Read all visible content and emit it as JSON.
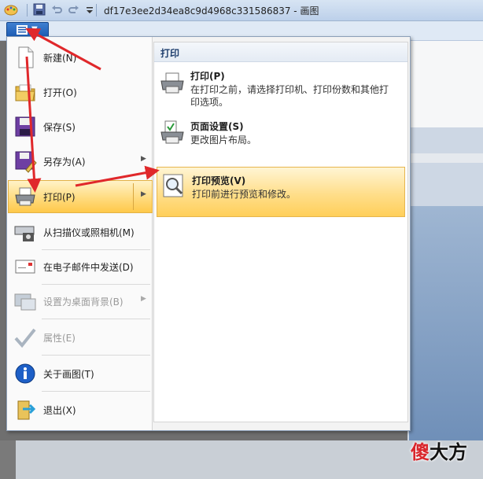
{
  "window": {
    "title": "df17e3ee2d34ea8c9d4968c331586837 - 画图"
  },
  "quick_access": {
    "icons": [
      "paint-app-icon",
      "save-icon",
      "undo-icon",
      "redo-icon",
      "customize-dropdown-icon"
    ]
  },
  "app_menu": {
    "items": [
      {
        "label": "新建(N)",
        "icon": "new-file-icon"
      },
      {
        "label": "打开(O)",
        "icon": "open-folder-icon"
      },
      {
        "label": "保存(S)",
        "icon": "floppy-disk-icon"
      },
      {
        "label": "另存为(A)",
        "icon": "save-as-icon",
        "submenu": true
      },
      {
        "label": "打印(P)",
        "icon": "printer-icon",
        "submenu": true,
        "highlighted": true
      },
      {
        "label": "从扫描仪或照相机(M)",
        "icon": "scanner-icon"
      },
      {
        "label": "在电子邮件中发送(D)",
        "icon": "email-icon"
      },
      {
        "label": "设置为桌面背景(B)",
        "icon": "desktop-background-icon",
        "submenu": true,
        "disabled": true
      },
      {
        "label": "属性(E)",
        "icon": "checkmark-icon",
        "disabled": true
      },
      {
        "label": "关于画图(T)",
        "icon": "info-icon"
      },
      {
        "label": "退出(X)",
        "icon": "exit-icon"
      }
    ]
  },
  "print_submenu": {
    "header": "打印",
    "items": [
      {
        "title": "打印(P)",
        "desc": "在打印之前，请选择打印机、打印份数和其他打印选项。",
        "icon": "printer-icon"
      },
      {
        "title": "页面设置(S)",
        "desc": "更改图片布局。",
        "icon": "page-setup-icon"
      },
      {
        "title": "打印预览(V)",
        "desc": "打印前进行预览和修改。",
        "icon": "print-preview-icon",
        "highlighted": true
      }
    ]
  },
  "watermark": {
    "first": "傻",
    "rest": "大方"
  },
  "colors": {
    "highlight": "#ffd978",
    "arrow": "#e0282b",
    "app_button": "#1c5bb3"
  }
}
